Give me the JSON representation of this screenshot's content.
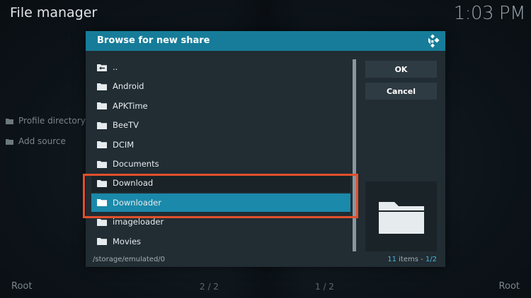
{
  "app": {
    "title": "File manager",
    "clock": "1:03 PM"
  },
  "sidebar": {
    "items": [
      {
        "label": "Profile directory",
        "icon": "folder-icon"
      },
      {
        "label": "Add source",
        "icon": "folder-icon"
      }
    ]
  },
  "footer": {
    "left_label": "Root",
    "right_label": "Root",
    "left_page": "2 / 2",
    "right_page": "1 / 2"
  },
  "dialog": {
    "title": "Browse for new share",
    "ok_label": "OK",
    "cancel_label": "Cancel",
    "path": "/storage/emulated/0",
    "count_num": "11",
    "count_label": " items - ",
    "count_page": "1/2",
    "items": [
      {
        "label": "..",
        "icon": "parent-folder-icon"
      },
      {
        "label": "Android",
        "icon": "folder-icon"
      },
      {
        "label": "APKTime",
        "icon": "folder-icon"
      },
      {
        "label": "BeeTV",
        "icon": "folder-icon"
      },
      {
        "label": "DCIM",
        "icon": "folder-icon"
      },
      {
        "label": "Documents",
        "icon": "folder-icon"
      },
      {
        "label": "Download",
        "icon": "folder-icon"
      },
      {
        "label": "Downloader",
        "icon": "folder-icon",
        "focused": true
      },
      {
        "label": "imageloader",
        "icon": "folder-icon"
      },
      {
        "label": "Movies",
        "icon": "folder-icon"
      }
    ]
  },
  "colors": {
    "header": "#167c99",
    "focus": "#1a89aa",
    "highlight_border": "#e1502b",
    "dialog_bg": "#212c33"
  }
}
